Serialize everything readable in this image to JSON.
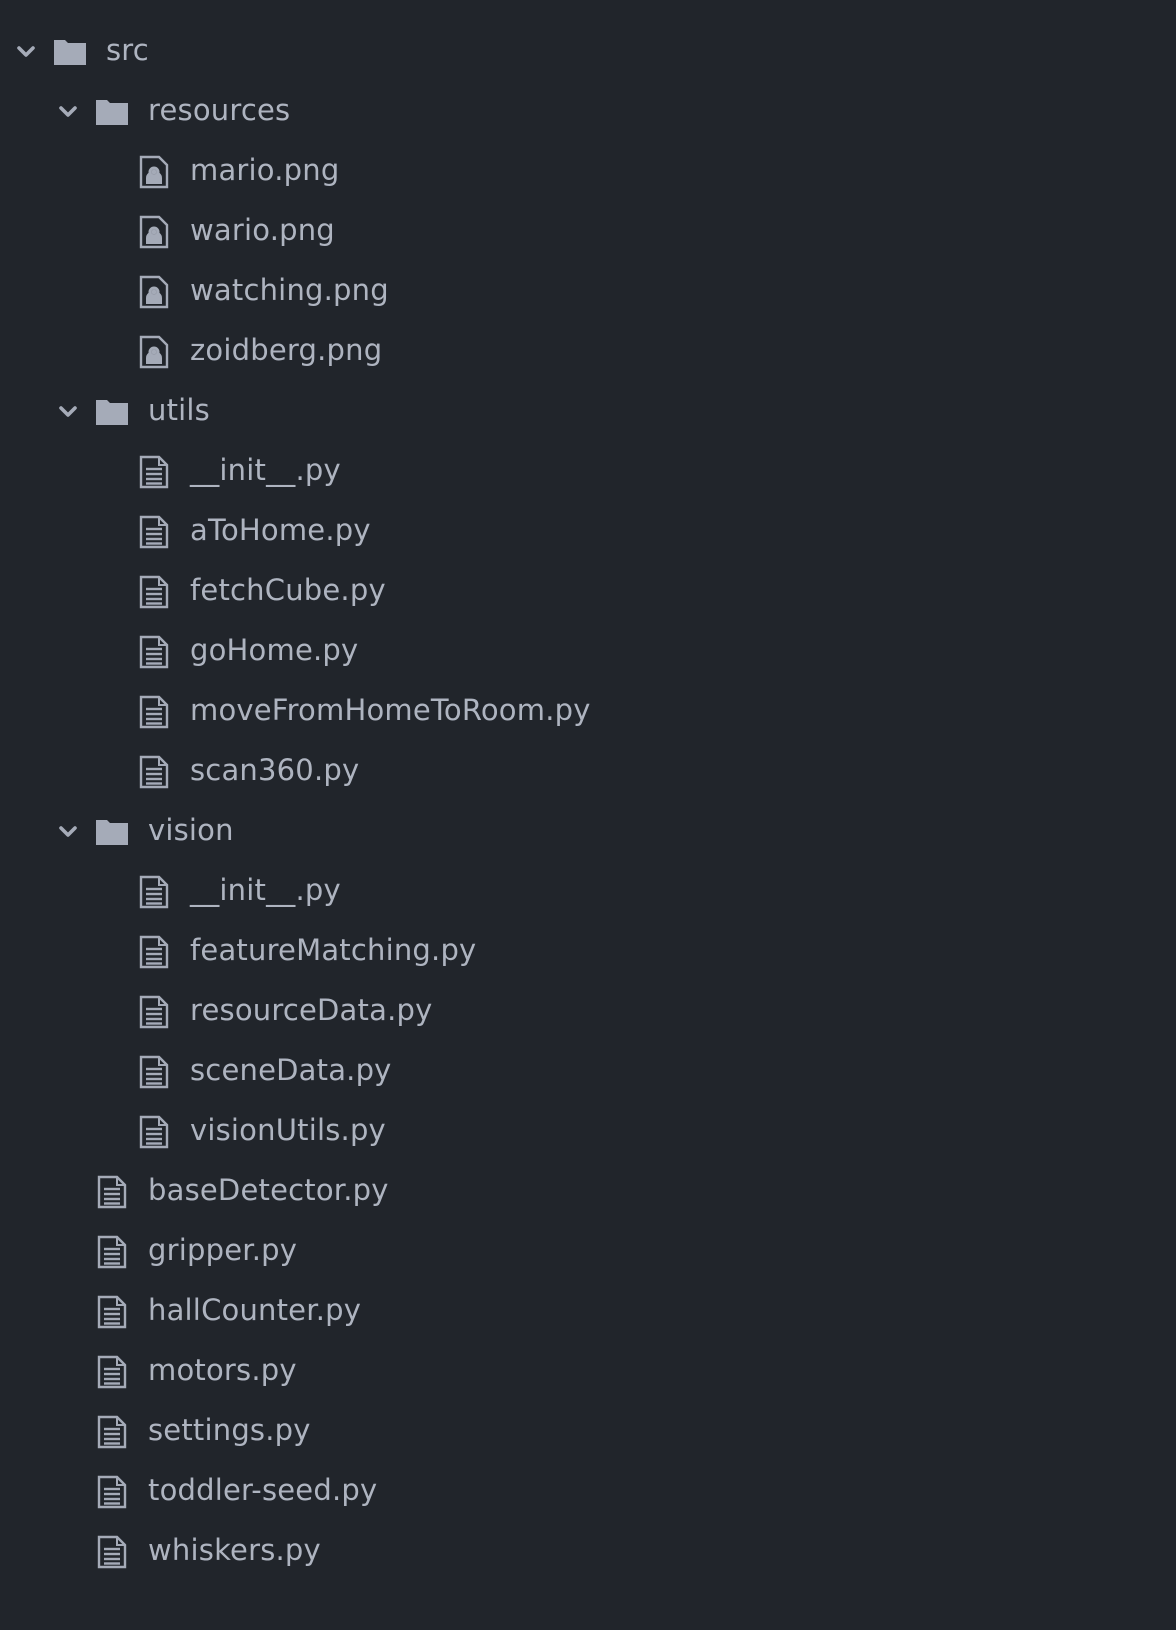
{
  "theme": {
    "background": "#21252b",
    "text": "#aeb4c0",
    "icon": "#a5abb8"
  },
  "tree": [
    {
      "label": "src",
      "type": "folder",
      "expanded": true,
      "depth": 0,
      "icon": "folder-icon"
    },
    {
      "label": "resources",
      "type": "folder",
      "expanded": true,
      "depth": 1,
      "icon": "folder-icon"
    },
    {
      "label": "mario.png",
      "type": "file",
      "depth": 2,
      "icon": "image-file-icon"
    },
    {
      "label": "wario.png",
      "type": "file",
      "depth": 2,
      "icon": "image-file-icon"
    },
    {
      "label": "watching.png",
      "type": "file",
      "depth": 2,
      "icon": "image-file-icon"
    },
    {
      "label": "zoidberg.png",
      "type": "file",
      "depth": 2,
      "icon": "image-file-icon"
    },
    {
      "label": "utils",
      "type": "folder",
      "expanded": true,
      "depth": 1,
      "icon": "folder-icon"
    },
    {
      "label": "__init__.py",
      "type": "file",
      "depth": 2,
      "icon": "text-file-icon"
    },
    {
      "label": "aToHome.py",
      "type": "file",
      "depth": 2,
      "icon": "text-file-icon"
    },
    {
      "label": "fetchCube.py",
      "type": "file",
      "depth": 2,
      "icon": "text-file-icon"
    },
    {
      "label": "goHome.py",
      "type": "file",
      "depth": 2,
      "icon": "text-file-icon"
    },
    {
      "label": "moveFromHomeToRoom.py",
      "type": "file",
      "depth": 2,
      "icon": "text-file-icon"
    },
    {
      "label": "scan360.py",
      "type": "file",
      "depth": 2,
      "icon": "text-file-icon"
    },
    {
      "label": "vision",
      "type": "folder",
      "expanded": true,
      "depth": 1,
      "icon": "folder-icon"
    },
    {
      "label": "__init__.py",
      "type": "file",
      "depth": 2,
      "icon": "text-file-icon"
    },
    {
      "label": "featureMatching.py",
      "type": "file",
      "depth": 2,
      "icon": "text-file-icon"
    },
    {
      "label": "resourceData.py",
      "type": "file",
      "depth": 2,
      "icon": "text-file-icon"
    },
    {
      "label": "sceneData.py",
      "type": "file",
      "depth": 2,
      "icon": "text-file-icon"
    },
    {
      "label": "visionUtils.py",
      "type": "file",
      "depth": 2,
      "icon": "text-file-icon"
    },
    {
      "label": "baseDetector.py",
      "type": "file",
      "depth": 1,
      "icon": "text-file-icon"
    },
    {
      "label": "gripper.py",
      "type": "file",
      "depth": 1,
      "icon": "text-file-icon"
    },
    {
      "label": "hallCounter.py",
      "type": "file",
      "depth": 1,
      "icon": "text-file-icon"
    },
    {
      "label": "motors.py",
      "type": "file",
      "depth": 1,
      "icon": "text-file-icon"
    },
    {
      "label": "settings.py",
      "type": "file",
      "depth": 1,
      "icon": "text-file-icon"
    },
    {
      "label": "toddler-seed.py",
      "type": "file",
      "depth": 1,
      "icon": "text-file-icon"
    },
    {
      "label": "whiskers.py",
      "type": "file",
      "depth": 1,
      "icon": "text-file-icon"
    }
  ]
}
